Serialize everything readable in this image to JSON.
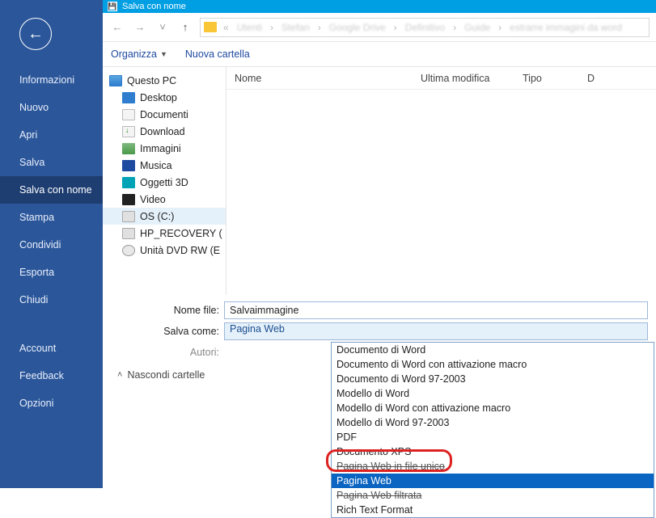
{
  "word_sidebar": {
    "items": [
      "Informazioni",
      "Nuovo",
      "Apri",
      "Salva",
      "Salva con nome",
      "Stampa",
      "Condividi",
      "Esporta",
      "Chiudi"
    ],
    "bottom_items": [
      "Account",
      "Feedback",
      "Opzioni"
    ],
    "selected_index": 4
  },
  "dialog": {
    "title": "Salva con nome",
    "breadcrumb": [
      "Utenti",
      "Stefan",
      "Google Drive",
      "Definitivo",
      "Guide",
      "estrarre immagini da word"
    ]
  },
  "toolbar": {
    "organize": "Organizza",
    "new_folder": "Nuova cartella"
  },
  "tree": {
    "root": "Questo PC",
    "children": [
      {
        "icon": "desktop",
        "label": "Desktop"
      },
      {
        "icon": "docs",
        "label": "Documenti"
      },
      {
        "icon": "download",
        "label": "Download"
      },
      {
        "icon": "img",
        "label": "Immagini"
      },
      {
        "icon": "music",
        "label": "Musica"
      },
      {
        "icon": "3d",
        "label": "Oggetti 3D"
      },
      {
        "icon": "video",
        "label": "Video"
      },
      {
        "icon": "drive",
        "label": "OS (C:)"
      },
      {
        "icon": "drive",
        "label": "HP_RECOVERY ("
      },
      {
        "icon": "cd",
        "label": "Unità DVD RW (E"
      }
    ],
    "selected_child_index": 7
  },
  "filelist": {
    "cols": [
      "Nome",
      "Ultima modifica",
      "Tipo",
      "D"
    ]
  },
  "form": {
    "filename_label": "Nome file:",
    "filename_value": "Salvaimmagine",
    "saveas_label": "Salva come:",
    "saveas_value": "Pagina Web",
    "authors_label": "Autori:"
  },
  "hide_folders": "Nascondi cartelle",
  "dropdown_options": [
    {
      "label": "Documento di Word"
    },
    {
      "label": "Documento di Word con attivazione macro"
    },
    {
      "label": "Documento di Word 97-2003"
    },
    {
      "label": "Modello di Word"
    },
    {
      "label": "Modello di Word con attivazione macro"
    },
    {
      "label": "Modello di Word 97-2003"
    },
    {
      "label": "PDF"
    },
    {
      "label": "Documento XPS"
    },
    {
      "label": "Pagina Web in file unico",
      "strike": true
    },
    {
      "label": "Pagina Web",
      "highlight": true
    },
    {
      "label": "Pagina Web filtrata",
      "strike": true
    },
    {
      "label": "Rich Text Format"
    }
  ]
}
